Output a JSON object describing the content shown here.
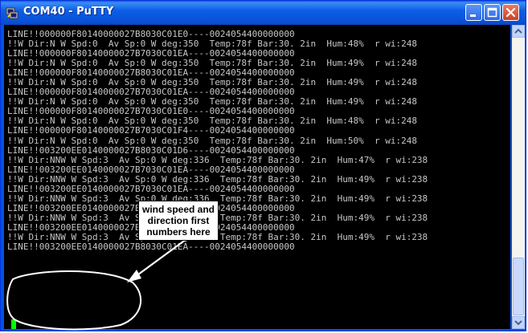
{
  "window": {
    "title": "COM40 - PuTTY"
  },
  "terminal": {
    "lines": [
      "LINE!!000000F80140000027B8030C01E0----0024054400000000",
      "!!W Dir:N W Spd:0  Av Sp:0 W deg:350  Temp:78f Bar:30. 2in  Hum:48%  r wi:248",
      "LINE!!000000F80140000027B7030C01EA----0024054400000000",
      "!!W Dir:N W Spd:0  Av Sp:0 W deg:350  Temp:78f Bar:30. 2in  Hum:49%  r wi:248",
      "LINE!!000000F80140000027B8030C01EA----0024054400000000",
      "!!W Dir:N W Spd:0  Av Sp:0 W deg:350  Temp:78f Bar:30. 2in  Hum:49%  r wi:248",
      "LINE!!000000F80140000027B7030C01EA----0024054400000000",
      "!!W Dir:N W Spd:0  Av Sp:0 W deg:350  Temp:78f Bar:30. 2in  Hum:49%  r wi:248",
      "LINE!!000000F80140000027B7030C01E0----0024054400000000",
      "!!W Dir:N W Spd:0  Av Sp:0 W deg:350  Temp:78f Bar:30. 2in  Hum:48%  r wi:248",
      "LINE!!000000F80140000027B7030C01F4----0024054400000000",
      "!!W Dir:N W Spd:0  Av Sp:0 W deg:350  Temp:78f Bar:30. 2in  Hum:50%  r wi:248",
      "LINE!!003200EE0140000027B8030C01D6----0024054400000000",
      "!!W Dir:NNW W Spd:3  Av Sp:0 W deg:336  Temp:78f Bar:30. 2in  Hum:47%  r wi:238",
      "LINE!!003200EE0140000027B7030C01EA----0024054400000000",
      "!!W Dir:NNW W Spd:3  Av Sp:0 W deg:336  Temp:78f Bar:30. 2in  Hum:49%  r wi:238",
      "LINE!!003200EE0140000027B7030C01EA----0024054400000000",
      "!!W Dir:NNW W Spd:3  Av Sp:0 W deg:336  Temp:78f Bar:30. 2in  Hum:49%  r wi:238",
      "LINE!!003200EE0140000027B7030C01EA----0024054400000000",
      "!!W Dir:NNW W Spd:3  Av Sp:0 W deg:336  Temp:78f Bar:30. 2in  Hum:49%  r wi:238",
      "LINE!!003200EE0140000027B7030C01EA----0024054400000000",
      "!!W Dir:NNW W Spd:3  Av Sp:0 W deg:336  Temp:78f Bar:30. 2in  Hum:49%  r wi:238",
      "LINE!!003200EE0140000027B8030C01EA----0024054400000000",
      ""
    ]
  },
  "annotation": {
    "line1": "wind speed and",
    "line2": "direction first",
    "line3": "numbers here"
  },
  "colors": {
    "titlebar": "#0054e3",
    "terminal_bg": "#000000",
    "terminal_text": "#c6c6c6",
    "cursor": "#00ff00",
    "close_button": "#c8412a"
  },
  "icons": {
    "app": "putty-icon",
    "minimize": "minimize-icon",
    "maximize": "maximize-icon",
    "close": "close-icon"
  }
}
